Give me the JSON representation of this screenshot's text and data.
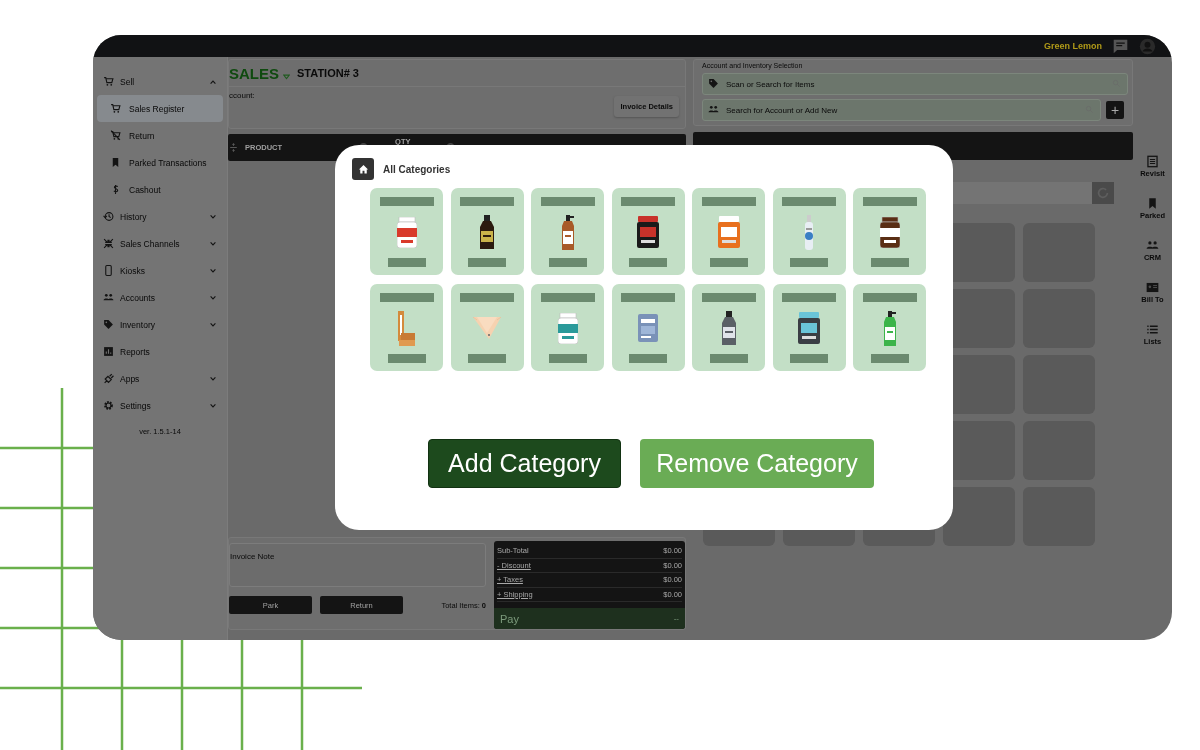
{
  "header": {
    "brand": "Green Lemon"
  },
  "sidebar": {
    "items": [
      {
        "label": "Sell",
        "kind": "group",
        "expanded": true,
        "selected": false,
        "children": [
          {
            "label": "Sales Register",
            "selected": true
          },
          {
            "label": "Return",
            "selected": false
          },
          {
            "label": "Parked Transactions",
            "selected": false
          },
          {
            "label": "Cashout",
            "selected": false
          }
        ]
      },
      {
        "label": "History",
        "kind": "group",
        "expanded": false,
        "selected": false
      },
      {
        "label": "Sales Channels",
        "kind": "group",
        "expanded": false,
        "selected": false
      },
      {
        "label": "Kiosks",
        "kind": "group",
        "expanded": false,
        "selected": false
      },
      {
        "label": "Accounts",
        "kind": "group",
        "expanded": false,
        "selected": false
      },
      {
        "label": "Inventory",
        "kind": "group",
        "expanded": false,
        "selected": false
      },
      {
        "label": "Reports",
        "kind": "link",
        "selected": false
      },
      {
        "label": "Apps",
        "kind": "group",
        "expanded": false,
        "selected": false
      },
      {
        "label": "Settings",
        "kind": "group",
        "expanded": false,
        "selected": false
      }
    ],
    "version": "ver. 1.5.1-14"
  },
  "sales": {
    "title": "SALES",
    "station": "STATION# 3",
    "account_label": "ccount:",
    "invoice_button": "Invoice Details",
    "columns": [
      "PRODUCT",
      "QTY"
    ]
  },
  "footer": {
    "note_placeholder": "Invoice Note",
    "buttons": [
      "Park",
      "Return"
    ],
    "total_items_label": "Total Items:",
    "total_items": "0",
    "totals": [
      {
        "label": "Sub-Total",
        "value": "$0.00",
        "kind": "plain"
      },
      {
        "label": "- Discount",
        "value": "$0.00",
        "kind": "link"
      },
      {
        "label": "+ Taxes",
        "value": "$0.00",
        "kind": "link"
      },
      {
        "label": "+ Shipping",
        "value": "$0.00",
        "kind": "link"
      }
    ],
    "pay": {
      "label": "Pay",
      "value": "--"
    }
  },
  "selection": {
    "title": "Account and Inventory Selection",
    "fields": [
      {
        "placeholder": "Scan or Search for Items"
      },
      {
        "placeholder": "Search for Account or Add New"
      }
    ],
    "add_button": "+"
  },
  "rail": [
    {
      "label": "Revisit"
    },
    {
      "label": "Parked"
    },
    {
      "label": "CRM"
    },
    {
      "label": "Bill To"
    },
    {
      "label": "Lists"
    }
  ],
  "modal": {
    "title": "All Categories",
    "buttons": [
      {
        "label": "Add Category",
        "kind": "primary"
      },
      {
        "label": "Remove Category",
        "kind": "secondary"
      }
    ]
  }
}
